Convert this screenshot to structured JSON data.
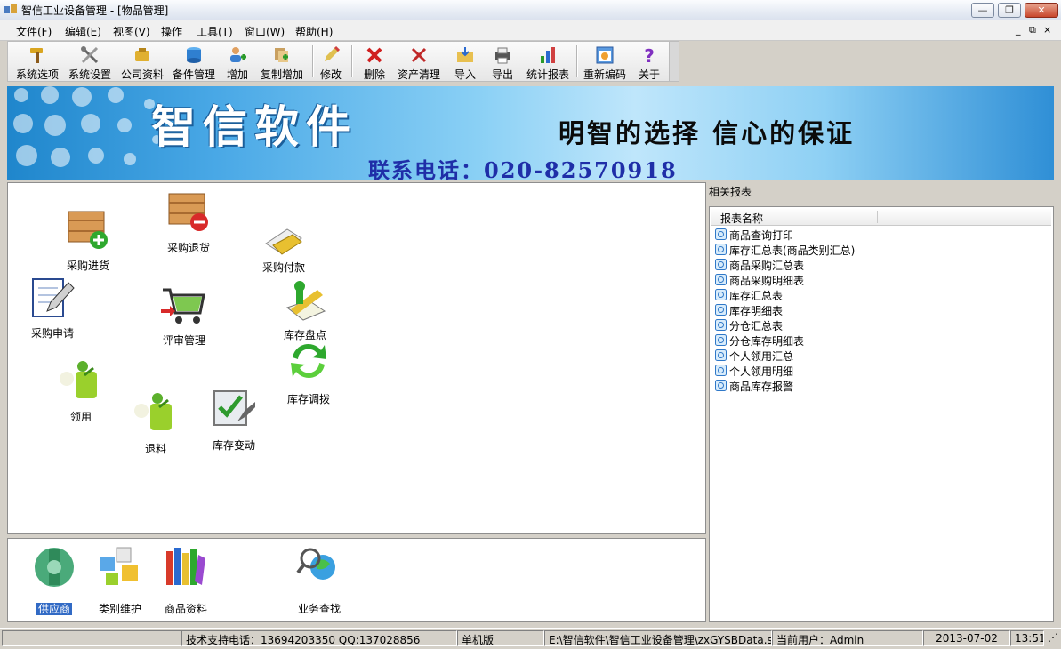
{
  "window": {
    "title": "智信工业设备管理 - [物品管理]",
    "controls": {
      "minimize": "—",
      "restore": "❐",
      "close": "✕"
    },
    "mdi_controls": {
      "minimize": "_",
      "restore": "⧉",
      "close": "×"
    }
  },
  "menu": [
    "文件(F)",
    "编辑(E)",
    "视图(V)",
    "操作",
    "工具(T)",
    "窗口(W)",
    "帮助(H)"
  ],
  "toolbar": [
    {
      "label": "系统选项",
      "icon": "hammer-icon"
    },
    {
      "label": "系统设置",
      "icon": "tools-icon"
    },
    {
      "label": "公司资料",
      "icon": "company-icon"
    },
    {
      "label": "备件管理",
      "icon": "database-icon"
    },
    {
      "label": "增加",
      "icon": "add-user-icon"
    },
    {
      "label": "复制增加",
      "icon": "copy-add-icon"
    },
    {
      "label": "修改",
      "icon": "pencil-icon"
    },
    {
      "label": "删除",
      "icon": "delete-x-icon"
    },
    {
      "label": "资产清理",
      "icon": "clean-x-icon"
    },
    {
      "label": "导入",
      "icon": "import-folder-icon"
    },
    {
      "label": "导出",
      "icon": "export-printer-icon"
    },
    {
      "label": "统计报表",
      "icon": "bar-chart-icon"
    },
    {
      "label": "重新编码",
      "icon": "recode-window-icon"
    },
    {
      "label": "关于",
      "icon": "question-icon"
    }
  ],
  "banner": {
    "main": "智信软件",
    "slogan": "明智的选择  信心的保证",
    "phone": "联系电话：020-82570918"
  },
  "functions": [
    {
      "label": "采购进货",
      "icon": "box-add-icon"
    },
    {
      "label": "采购退货",
      "icon": "box-remove-icon"
    },
    {
      "label": "采购付款",
      "icon": "money-icon"
    },
    {
      "label": "采购申请",
      "icon": "notebook-pencil-icon"
    },
    {
      "label": "评审管理",
      "icon": "shopping-cart-icon"
    },
    {
      "label": "库存盘点",
      "icon": "inventory-check-icon"
    },
    {
      "label": "库存调拨",
      "icon": "recycle-arrows-icon"
    },
    {
      "label": "领用",
      "icon": "puzzle-person-icon"
    },
    {
      "label": "退料",
      "icon": "puzzle-person-icon"
    },
    {
      "label": "库存变动",
      "icon": "checklist-icon"
    }
  ],
  "shortcuts": [
    {
      "label": "供应商",
      "icon": "supplier-icon",
      "selected": true
    },
    {
      "label": "类别维护",
      "icon": "category-cubes-icon"
    },
    {
      "label": "商品资料",
      "icon": "books-icon"
    },
    {
      "label": "业务查找",
      "icon": "magnifier-globe-icon"
    }
  ],
  "reports": {
    "title": "相关报表",
    "column": "报表名称",
    "items": [
      "商品查询打印",
      "库存汇总表(商品类别汇总)",
      "商品采购汇总表",
      "商品采购明细表",
      "库存汇总表",
      "库存明细表",
      "分仓汇总表",
      "分仓库存明细表",
      "个人领用汇总",
      "个人领用明细",
      "商品库存报警"
    ]
  },
  "status": {
    "support": "技术支持电话：13694203350 QQ:137028856",
    "mode": "单机版",
    "path": "E:\\智信软件\\智信工业设备管理\\zxGYSBData.sys",
    "user": "当前用户：Admin",
    "date": "2013-07-02",
    "time": "13:51"
  },
  "colors": {
    "banner_blue": "#2f8fd6",
    "phone_text": "#1f2ea8",
    "selection": "#316ac5",
    "window_bg": "#d4d0c8"
  }
}
